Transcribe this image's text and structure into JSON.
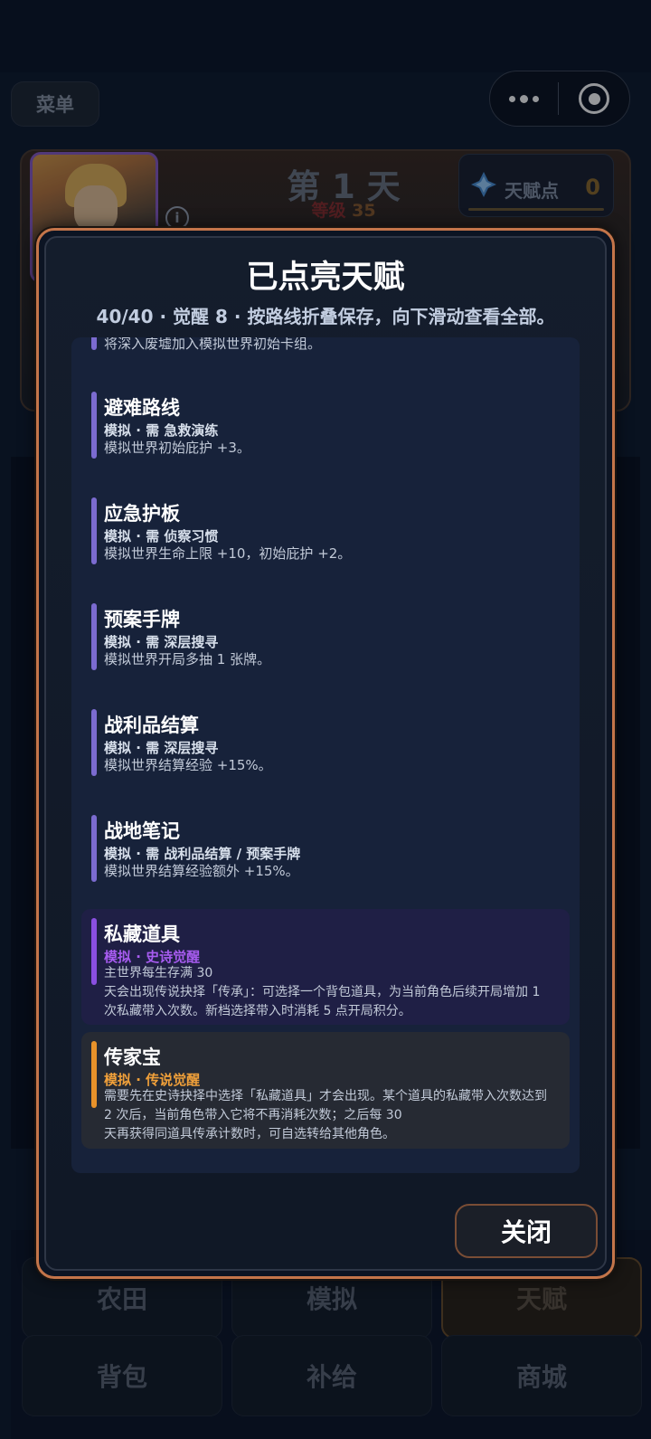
{
  "topbar": {
    "menu_label": "菜单"
  },
  "header": {
    "day_title": "第 1 天",
    "level_label": "等级",
    "level_value": "35",
    "talent_points_label": "天赋点",
    "talent_points_value": "0"
  },
  "nav": {
    "row1": [
      "农田",
      "模拟",
      "天赋"
    ],
    "row2": [
      "背包",
      "补给",
      "商城"
    ],
    "active": "天赋"
  },
  "modal": {
    "title": "已点亮天赋",
    "subtitle": "40/40 · 觉醒 8 · 按路线折叠保存，向下滑动查看全部。",
    "items": [
      {
        "name": "",
        "req": "",
        "desc": "将深入废墟加入模拟世界初始卡组。",
        "kind": "normal"
      },
      {
        "name": "避难路线",
        "req": "模拟 · 需 急救演练",
        "desc": "模拟世界初始庇护 +3。",
        "kind": "normal"
      },
      {
        "name": "应急护板",
        "req": "模拟 · 需 侦察习惯",
        "desc": "模拟世界生命上限 +10，初始庇护 +2。",
        "kind": "normal"
      },
      {
        "name": "预案手牌",
        "req": "模拟 · 需 深层搜寻",
        "desc": "模拟世界开局多抽 1 张牌。",
        "kind": "normal"
      },
      {
        "name": "战利品结算",
        "req": "模拟 · 需 深层搜寻",
        "desc": "模拟世界结算经验 +15%。",
        "kind": "normal"
      },
      {
        "name": "战地笔记",
        "req": "模拟 · 需 战利品结算 / 预案手牌",
        "desc": "模拟世界结算经验额外 +15%。",
        "kind": "normal"
      },
      {
        "name": "私藏道具",
        "req": "模拟 · 史诗觉醒",
        "desc1": "主世界每生存满 30",
        "desc": "天会出现传说抉择「传承」：可选择一个背包道具，为当前角色后续开局增加 1 次私藏带入次数。新档选择带入时消耗 5 点开局积分。",
        "kind": "epic"
      },
      {
        "name": "传家宝",
        "req": "模拟 · 传说觉醒",
        "desc": "需要先在史诗抉择中选择「私藏道具」才会出现。某个道具的私藏带入次数达到 2 次后，当前角色带入它将不再消耗次数；之后每 30",
        "desc2": "天再获得同道具传承计数时，可自选转给其他角色。",
        "kind": "legend"
      }
    ],
    "close_label": "关闭"
  },
  "colors": {
    "accent_normal": "#7b6bd0",
    "accent_epic": "#8a4fe0",
    "accent_legend": "#e8922a",
    "modal_border": "#c4754a"
  }
}
